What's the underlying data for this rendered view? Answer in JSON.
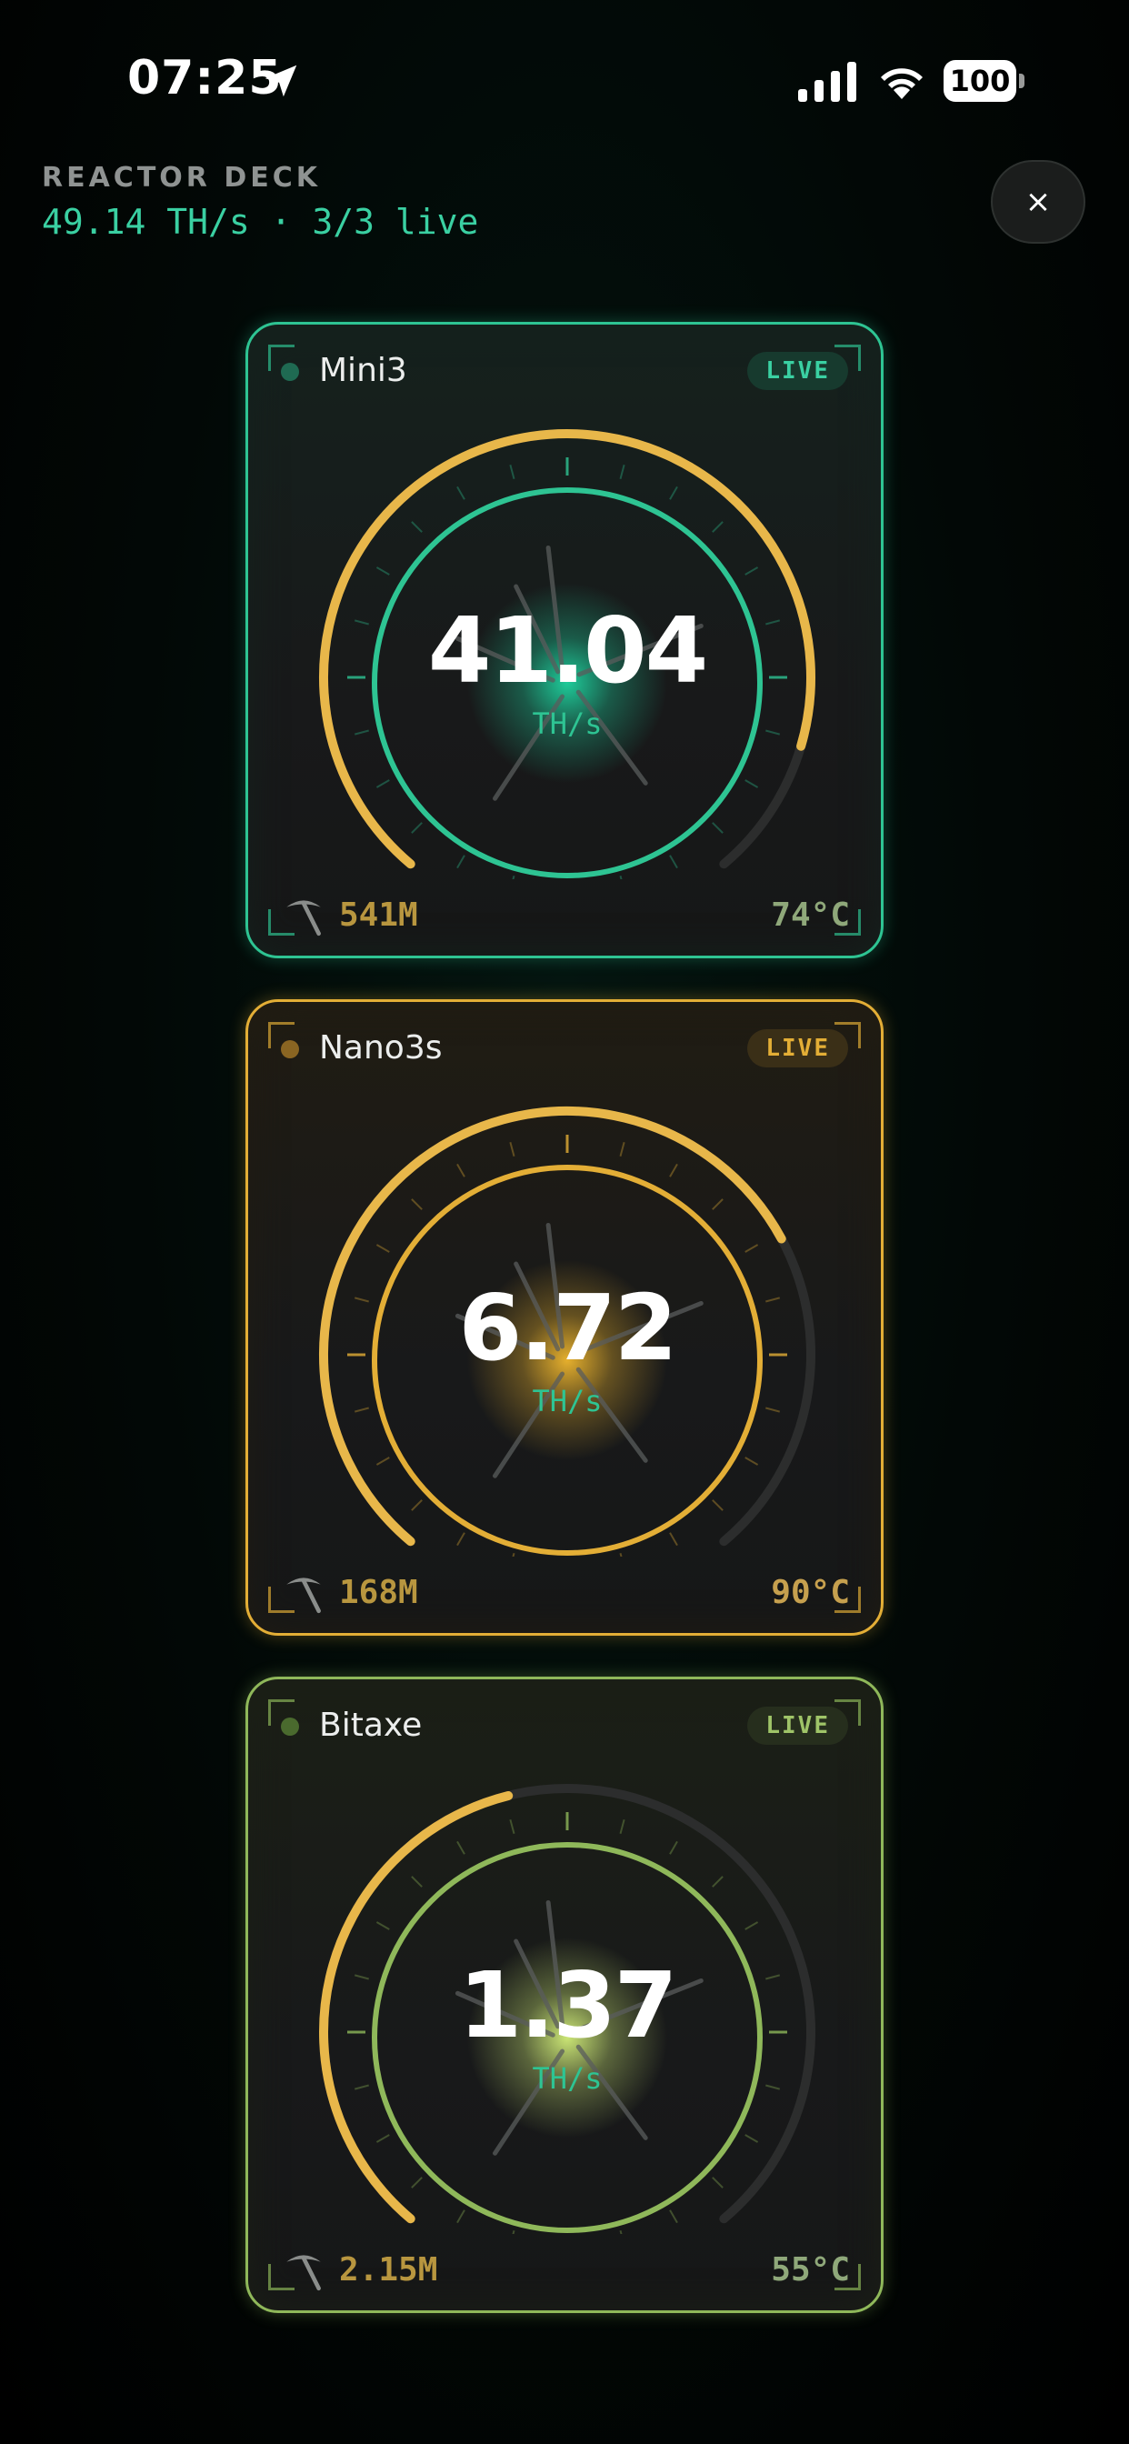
{
  "status_bar": {
    "time": "07:25",
    "battery": "100"
  },
  "header": {
    "label": "REACTOR DECK",
    "summary": "49.14 TH/s · 3/3 live",
    "close_label": "×"
  },
  "miners": [
    {
      "name": "Mini3",
      "badge": "LIVE",
      "hashrate": "41.04",
      "unit": "TH/s",
      "shares": "541M",
      "temp": "74°C",
      "power_fraction": 0.88,
      "accent": "#2ec493",
      "bg_tint": "#15211d",
      "dot": "#1f6a52",
      "badge_bg": "#173a2e",
      "badge_color": "#3ad0a2",
      "shares_color": "#b8963f",
      "temp_color": "#8fa87a",
      "glow": "#1fd4a0"
    },
    {
      "name": "Nano3s",
      "badge": "LIVE",
      "hashrate": "6.72",
      "unit": "TH/s",
      "shares": "168M",
      "temp": "90°C",
      "power_fraction": 0.72,
      "accent": "#e3ae36",
      "bg_tint": "#201c13",
      "dot": "#8a6522",
      "badge_bg": "#3a2f17",
      "badge_color": "#e3ae36",
      "shares_color": "#b8963f",
      "temp_color": "#c6a04e",
      "glow": "#f0b72e"
    },
    {
      "name": "Bitaxe",
      "badge": "LIVE",
      "hashrate": "1.37",
      "unit": "TH/s",
      "shares": "2.15M",
      "temp": "55°C",
      "power_fraction": 0.45,
      "accent": "#8fb85a",
      "bg_tint": "#1b1f16",
      "dot": "#4a6a2e",
      "badge_bg": "#262e1d",
      "badge_color": "#9fc468",
      "shares_color": "#b8963f",
      "temp_color": "#8fa87a",
      "glow": "#d4f07a"
    }
  ]
}
